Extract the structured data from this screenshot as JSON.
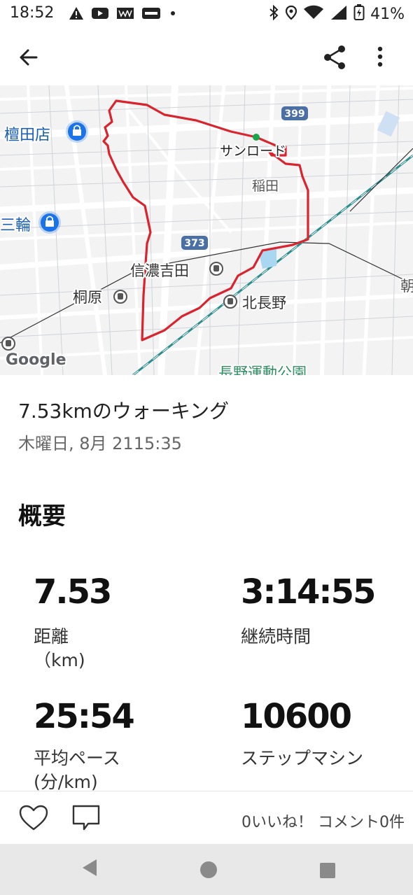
{
  "status_bar": {
    "time": "18:52",
    "battery": "41%",
    "icons": [
      "warning-icon",
      "youtube-icon",
      "www-icon",
      "view-icon",
      "dot-icon",
      "bluetooth-icon",
      "location-icon",
      "wifi-icon",
      "signal-icon",
      "battery-icon"
    ]
  },
  "app_bar": {
    "icons": [
      "back-arrow-icon",
      "share-icon",
      "more-vert-icon"
    ]
  },
  "map": {
    "labels": {
      "store1": "檀田店",
      "store2": "三輪",
      "start": "サンロード",
      "area1": "稲田",
      "station1": "信濃吉田",
      "station2": "桐原",
      "station3": "北長野",
      "park": "長野運動公園",
      "edge": "朝",
      "road1": "399",
      "road2": "373",
      "attribution": "Google"
    },
    "route_color": "#d9232d"
  },
  "activity": {
    "title": "7.53kmのウォーキング",
    "datetime": "木曜日, 8月 2115:35"
  },
  "summary": {
    "heading": "概要",
    "stats": [
      {
        "value": "7.53",
        "label": "距離",
        "unit": "（km)"
      },
      {
        "value": "3:14:55",
        "label": "継続時間",
        "unit": ""
      },
      {
        "value": "25:54",
        "label": "平均ペース",
        "unit": "(分/km)"
      },
      {
        "value": "10600",
        "label": "ステップマシン",
        "unit": ""
      }
    ]
  },
  "footer": {
    "counts": "0いいね！ コメント0件"
  }
}
